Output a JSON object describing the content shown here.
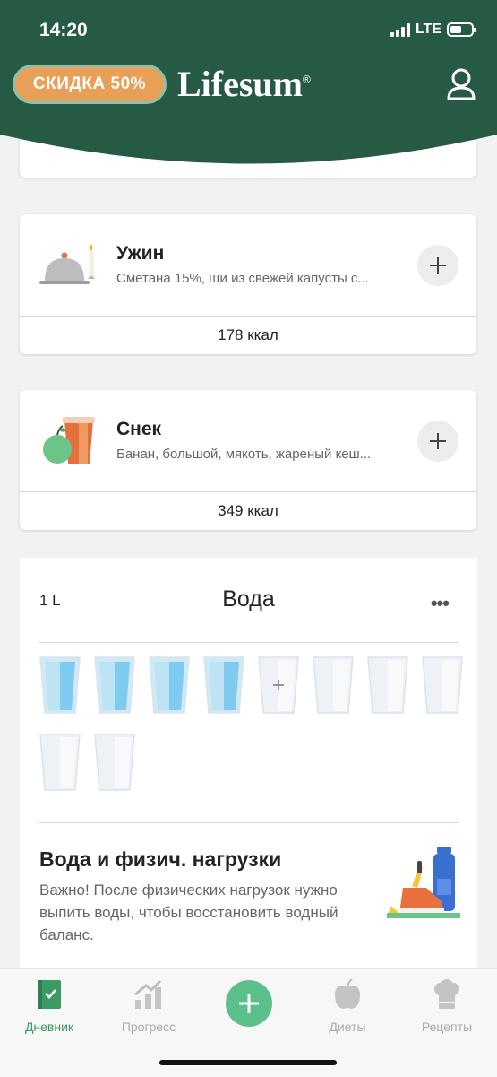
{
  "status": {
    "time": "14:20",
    "network": "LTE"
  },
  "header": {
    "discount_label": "СКИДКА 50%",
    "brand": "Lifesum",
    "brand_mark": "®",
    "brand_color": "#265a44"
  },
  "meals": [
    {
      "title": "Ужин",
      "description": "Сметана 15%, щи из свежей капусты с...",
      "kcal": "178 ккал",
      "icon": "dinner-cloche-icon"
    },
    {
      "title": "Снек",
      "description": "Банан, большой, мякоть, жареный кеш...",
      "kcal": "349 ккал",
      "icon": "snack-apple-cup-icon"
    }
  ],
  "water": {
    "amount": "1 L",
    "title": "Вода",
    "more": "•••",
    "glasses_filled": 4,
    "glasses_total": 10,
    "tip_title": "Вода и физич. нагрузки",
    "tip_text": "Важно! После физических нагрузок нужно выпить воды, чтобы восстановить водный баланс."
  },
  "tabs": [
    {
      "label": "Дневник",
      "icon": "diary-book-icon",
      "active": true
    },
    {
      "label": "Прогресс",
      "icon": "progress-chart-icon",
      "active": false
    },
    {
      "label": "",
      "icon": "add-plus-icon",
      "active": false
    },
    {
      "label": "Диеты",
      "icon": "diets-apple-icon",
      "active": false
    },
    {
      "label": "Рецепты",
      "icon": "recipes-chef-hat-icon",
      "active": false
    }
  ],
  "colors": {
    "accent": "#5cc08a",
    "discount": "#e8a058",
    "active_tab": "#3c9a64"
  }
}
